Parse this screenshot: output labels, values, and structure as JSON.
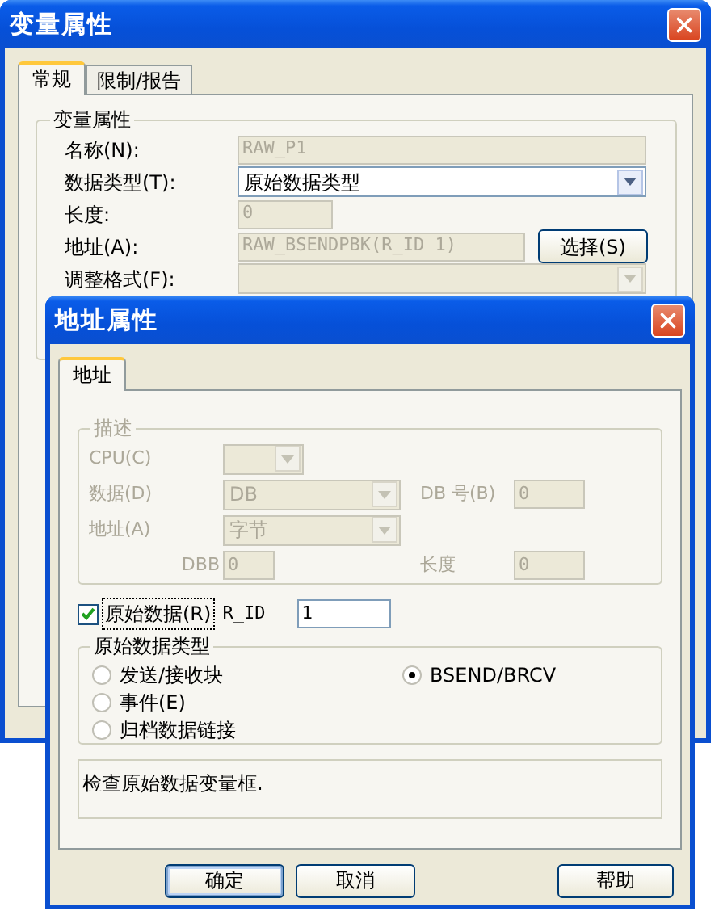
{
  "back_window": {
    "title": "变量属性",
    "tabs": [
      {
        "label": "常规",
        "selected": true
      },
      {
        "label": "限制/报告",
        "selected": false
      }
    ],
    "group_title": "变量属性",
    "fields": [
      {
        "kind": "text",
        "label": "名称(N):",
        "value": "RAW_P1",
        "disabled": true
      },
      {
        "kind": "dropdown",
        "label": "数据类型(T):",
        "value": "原始数据类型",
        "disabled": false
      },
      {
        "kind": "short",
        "label": "长度:",
        "value": "0",
        "disabled": true
      },
      {
        "kind": "address",
        "label": "地址(A):",
        "value": "RAW_BSENDPBK(R_ID 1)",
        "disabled": true,
        "button": "选择(S)"
      },
      {
        "kind": "dropdown",
        "label": "调整格式(F):",
        "disabled": true
      }
    ]
  },
  "front_window": {
    "title": "地址属性",
    "tabs": [
      {
        "label": "地址",
        "selected": true
      }
    ],
    "description": {
      "title": "描述",
      "disabled": true,
      "cpu": {
        "label": "CPU(C)"
      },
      "data": {
        "label": "数据(D)",
        "value": "DB"
      },
      "db_number": {
        "label": "DB 号(B)",
        "value": "0"
      },
      "address": {
        "label": "地址(A)",
        "value": "字节"
      },
      "dbb": {
        "label": "DBB",
        "value": "0"
      },
      "length": {
        "label": "长度",
        "value": "0"
      }
    },
    "raw_data": {
      "label": "原始数据(R)",
      "checked": true
    },
    "r_id": {
      "label": "R_ID",
      "value": "1"
    },
    "raw_types": {
      "title": "原始数据类型",
      "options": [
        {
          "label": "发送/接收块",
          "selected": false
        },
        {
          "label": "BSEND/BRCV",
          "selected": true
        },
        {
          "label": "事件(E)",
          "selected": false
        },
        {
          "label": "归档数据链接",
          "selected": false
        }
      ]
    },
    "status": "检查原始数据变量框.",
    "buttons": [
      {
        "label": "确定",
        "default": true
      },
      {
        "label": "取消",
        "default": false
      },
      {
        "label": "帮助",
        "default": false
      }
    ]
  }
}
